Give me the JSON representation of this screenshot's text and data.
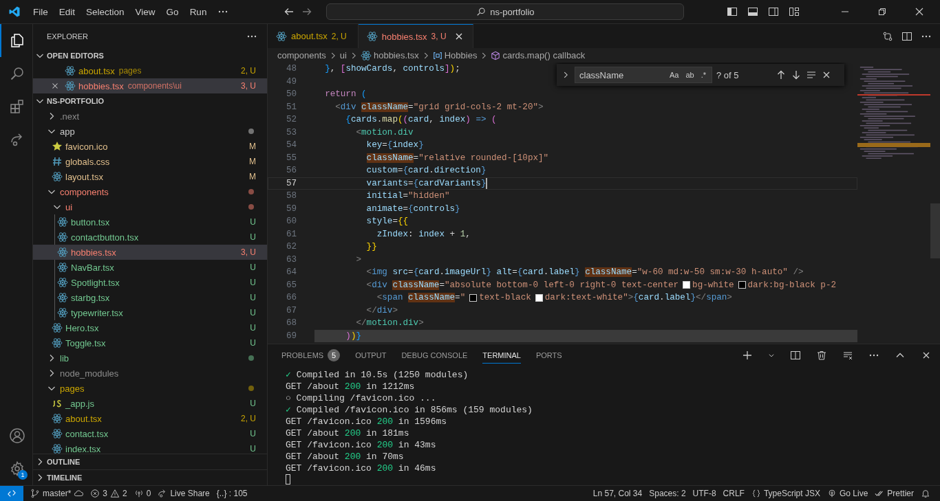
{
  "title_bar": {
    "menu": [
      "File",
      "Edit",
      "Selection",
      "View",
      "Go",
      "Run"
    ],
    "search": {
      "value": "ns-portfolio"
    }
  },
  "activity_bar": {
    "items": [
      {
        "kind": "explorer",
        "selected": true
      },
      {
        "kind": "search",
        "selected": false
      },
      {
        "kind": "extensions",
        "selected": false
      },
      {
        "kind": "live-share",
        "selected": false
      }
    ],
    "settings_badge": "1"
  },
  "explorer": {
    "title": "EXPLORER",
    "open_editors": {
      "title": "OPEN EDITORS",
      "expanded": true,
      "items": [
        {
          "name": "about.tsx",
          "path": "pages",
          "badge": "2, U",
          "color": "#cca700",
          "selected": false
        },
        {
          "name": "hobbies.tsx",
          "path": "components\\ui",
          "badge": "3, U",
          "color": "#f88070",
          "selected": true
        }
      ]
    },
    "project": {
      "title": "NS-PORTFOLIO",
      "expanded": true,
      "children": [
        {
          "name": ".next",
          "kind": "folder",
          "expanded": false,
          "color": "#8c8c8c",
          "dot": false,
          "selected": false
        },
        {
          "name": "app",
          "kind": "folder",
          "expanded": true,
          "color": "#cccccc",
          "dot": true,
          "selected": false,
          "children": [
            {
              "name": "favicon.ico",
              "kind": "star",
              "color": "#e2c08d",
              "badge": "M",
              "selected": false
            },
            {
              "name": "globals.css",
              "kind": "css",
              "color": "#e2c08d",
              "badge": "M",
              "selected": false
            },
            {
              "name": "layout.tsx",
              "kind": "react",
              "color": "#e2c08d",
              "badge": "M",
              "selected": false
            }
          ]
        },
        {
          "name": "components",
          "kind": "folder",
          "expanded": true,
          "color": "#f88070",
          "dot": true,
          "selected": false,
          "children": [
            {
              "name": "ui",
              "kind": "folder",
              "expanded": true,
              "color": "#f88070",
              "dot": true,
              "selected": false,
              "children": [
                {
                  "name": "button.tsx",
                  "kind": "react",
                  "color": "#73c991",
                  "badge": "U",
                  "selected": false
                },
                {
                  "name": "contactbutton.tsx",
                  "kind": "react",
                  "color": "#73c991",
                  "badge": "U",
                  "selected": false
                },
                {
                  "name": "hobbies.tsx",
                  "kind": "react",
                  "color": "#f88070",
                  "badge": "3, U",
                  "selected": true
                },
                {
                  "name": "NavBar.tsx",
                  "kind": "react",
                  "color": "#73c991",
                  "badge": "U",
                  "selected": false
                },
                {
                  "name": "Spotlight.tsx",
                  "kind": "react",
                  "color": "#73c991",
                  "badge": "U",
                  "selected": false
                },
                {
                  "name": "starbg.tsx",
                  "kind": "react",
                  "color": "#73c991",
                  "badge": "U",
                  "selected": false
                },
                {
                  "name": "typewriter.tsx",
                  "kind": "react",
                  "color": "#73c991",
                  "badge": "U",
                  "selected": false
                }
              ]
            },
            {
              "name": "Hero.tsx",
              "kind": "react",
              "color": "#73c991",
              "badge": "U",
              "selected": false
            },
            {
              "name": "Toggle.tsx",
              "kind": "react",
              "color": "#73c991",
              "badge": "U",
              "selected": false
            }
          ]
        },
        {
          "name": "lib",
          "kind": "folder",
          "expanded": false,
          "color": "#73c991",
          "dot": true,
          "selected": false
        },
        {
          "name": "node_modules",
          "kind": "folder",
          "expanded": false,
          "color": "#8c8c8c",
          "dot": false,
          "selected": false
        },
        {
          "name": "pages",
          "kind": "folder",
          "expanded": true,
          "color": "#cca700",
          "dot": true,
          "selected": false,
          "children": [
            {
              "name": "_app.js",
              "kind": "js",
              "color": "#73c991",
              "badge": "U",
              "selected": false
            },
            {
              "name": "about.tsx",
              "kind": "react",
              "color": "#cca700",
              "badge": "2, U",
              "selected": false
            },
            {
              "name": "contact.tsx",
              "kind": "react",
              "color": "#73c991",
              "badge": "U",
              "selected": false
            },
            {
              "name": "index.tsx",
              "kind": "react",
              "color": "#73c991",
              "badge": "U",
              "selected": false
            }
          ]
        }
      ]
    },
    "sections": [
      {
        "title": "OUTLINE",
        "expanded": false
      },
      {
        "title": "TIMELINE",
        "expanded": false
      }
    ]
  },
  "tabs": [
    {
      "name": "about.tsx",
      "badge": "2, U",
      "color": "#cca700",
      "selected": false
    },
    {
      "name": "hobbies.tsx",
      "badge": "3, U",
      "color": "#f88070",
      "selected": true
    }
  ],
  "breadcrumbs": [
    {
      "text": "components",
      "kind": "folder"
    },
    {
      "text": "ui",
      "kind": "folder"
    },
    {
      "text": "hobbies.tsx",
      "kind": "react"
    },
    {
      "text": "Hobbies",
      "kind": "symbol"
    },
    {
      "text": "cards.map() callback",
      "kind": "method"
    }
  ],
  "find": {
    "value": "className",
    "options": [
      {
        "label": "Aa",
        "on": false
      },
      {
        "label": "ab",
        "on": false
      },
      {
        "label": ".*",
        "on": false
      }
    ],
    "count": "? of 5"
  },
  "code": [
    {
      "number": "48",
      "kind": "plain",
      "tokens": [
        {
          "text": "  }",
          "kind": "b3"
        },
        {
          "text": ",",
          "kind": "plain"
        },
        {
          "text": " [",
          "kind": "b2"
        },
        {
          "text": "showCards",
          "kind": "var"
        },
        {
          "text": ",",
          "kind": "plain"
        },
        {
          "text": " controls",
          "kind": "var"
        },
        {
          "text": "]",
          "kind": "b2"
        },
        {
          "text": ")",
          "kind": "b1"
        },
        {
          "text": ";",
          "kind": "plain"
        }
      ]
    },
    {
      "number": "49",
      "kind": "plain"
    },
    {
      "number": "50",
      "kind": "plain",
      "tokens": [
        {
          "text": "  return",
          "kind": "kw"
        },
        {
          "text": " (",
          "kind": "b3"
        }
      ]
    },
    {
      "number": "51",
      "kind": "plain",
      "tokens": [
        {
          "text": "    <",
          "kind": "punct"
        },
        {
          "text": "div",
          "kind": "tag"
        },
        {
          "text": " className",
          "kind": "match"
        },
        {
          "text": "=",
          "kind": "plain"
        },
        {
          "text": "\"grid grid-cols-2 mt-20\"",
          "kind": "str"
        },
        {
          "text": ">",
          "kind": "punct"
        }
      ]
    },
    {
      "number": "52",
      "kind": "plain",
      "tokens": [
        {
          "text": "      {",
          "kind": "b3"
        },
        {
          "text": "cards",
          "kind": "var"
        },
        {
          "text": ".",
          "kind": "plain"
        },
        {
          "text": "map",
          "kind": "fn"
        },
        {
          "text": "(",
          "kind": "b1"
        },
        {
          "text": "(",
          "kind": "b2"
        },
        {
          "text": "card",
          "kind": "var"
        },
        {
          "text": ",",
          "kind": "plain"
        },
        {
          "text": " index",
          "kind": "var"
        },
        {
          "text": ")",
          "kind": "b2"
        },
        {
          "text": " =>",
          "kind": "tag"
        },
        {
          "text": " (",
          "kind": "b2"
        }
      ]
    },
    {
      "number": "53",
      "kind": "plain",
      "tokens": [
        {
          "text": "        <",
          "kind": "punct"
        },
        {
          "text": "motion.div",
          "kind": "comp"
        }
      ]
    },
    {
      "number": "54",
      "kind": "plain",
      "tokens": [
        {
          "text": "          key",
          "kind": "attr"
        },
        {
          "text": "=",
          "kind": "plain"
        },
        {
          "text": "{",
          "kind": "tag"
        },
        {
          "text": "index",
          "kind": "var"
        },
        {
          "text": "}",
          "kind": "tag"
        }
      ]
    },
    {
      "number": "55",
      "kind": "plain",
      "tokens": [
        {
          "text": "          className",
          "kind": "match"
        },
        {
          "text": "=",
          "kind": "plain"
        },
        {
          "text": "\"relative rounded-[10px]\"",
          "kind": "str"
        }
      ]
    },
    {
      "number": "56",
      "kind": "plain",
      "tokens": [
        {
          "text": "          custom",
          "kind": "attr"
        },
        {
          "text": "=",
          "kind": "plain"
        },
        {
          "text": "{",
          "kind": "tag"
        },
        {
          "text": "card",
          "kind": "var"
        },
        {
          "text": ".",
          "kind": "plain"
        },
        {
          "text": "direction",
          "kind": "var"
        },
        {
          "text": "}",
          "kind": "tag"
        }
      ]
    },
    {
      "number": "57",
      "kind": "current",
      "tokens": [
        {
          "text": "          variants",
          "kind": "attr"
        },
        {
          "text": "=",
          "kind": "plain"
        },
        {
          "text": "{",
          "kind": "tag"
        },
        {
          "text": "cardVariants",
          "kind": "var"
        },
        {
          "text": "}",
          "kind": "tag"
        }
      ]
    },
    {
      "number": "58",
      "kind": "plain",
      "tokens": [
        {
          "text": "          initial",
          "kind": "attr"
        },
        {
          "text": "=",
          "kind": "plain"
        },
        {
          "text": "\"hidden\"",
          "kind": "str"
        }
      ]
    },
    {
      "number": "59",
      "kind": "plain",
      "tokens": [
        {
          "text": "          animate",
          "kind": "attr"
        },
        {
          "text": "=",
          "kind": "plain"
        },
        {
          "text": "{",
          "kind": "tag"
        },
        {
          "text": "controls",
          "kind": "var"
        },
        {
          "text": "}",
          "kind": "tag"
        }
      ]
    },
    {
      "number": "60",
      "kind": "plain",
      "tokens": [
        {
          "text": "          style",
          "kind": "attr"
        },
        {
          "text": "=",
          "kind": "plain"
        },
        {
          "text": "{{",
          "kind": "b1"
        }
      ]
    },
    {
      "number": "61",
      "kind": "plain",
      "tokens": [
        {
          "text": "            zIndex",
          "kind": "var"
        },
        {
          "text": ":",
          "kind": "plain"
        },
        {
          "text": " index",
          "kind": "var"
        },
        {
          "text": " +",
          "kind": "plain"
        },
        {
          "text": " 1",
          "kind": "num"
        },
        {
          "text": ",",
          "kind": "plain"
        }
      ]
    },
    {
      "number": "62",
      "kind": "plain",
      "tokens": [
        {
          "text": "          }}",
          "kind": "b1"
        }
      ]
    },
    {
      "number": "63",
      "kind": "plain",
      "tokens": [
        {
          "text": "        >",
          "kind": "punct"
        }
      ]
    },
    {
      "number": "64",
      "kind": "plain",
      "tokens": [
        {
          "text": "          <",
          "kind": "punct"
        },
        {
          "text": "img",
          "kind": "tag"
        },
        {
          "text": " src",
          "kind": "attr"
        },
        {
          "text": "=",
          "kind": "plain"
        },
        {
          "text": "{",
          "kind": "tag"
        },
        {
          "text": "card",
          "kind": "var"
        },
        {
          "text": ".",
          "kind": "plain"
        },
        {
          "text": "imageUrl",
          "kind": "var"
        },
        {
          "text": "}",
          "kind": "tag"
        },
        {
          "text": " alt",
          "kind": "attr"
        },
        {
          "text": "=",
          "kind": "plain"
        },
        {
          "text": "{",
          "kind": "tag"
        },
        {
          "text": "card",
          "kind": "var"
        },
        {
          "text": ".",
          "kind": "plain"
        },
        {
          "text": "label",
          "kind": "var"
        },
        {
          "text": "}",
          "kind": "tag"
        },
        {
          "text": " className",
          "kind": "match"
        },
        {
          "text": "=",
          "kind": "plain"
        },
        {
          "text": "\"w-60 md:w-50 sm:w-30 h-auto\"",
          "kind": "str"
        },
        {
          "text": " />",
          "kind": "punct"
        }
      ]
    },
    {
      "number": "65",
      "kind": "plain",
      "tokens": [
        {
          "text": "          <",
          "kind": "punct"
        },
        {
          "text": "div",
          "kind": "tag"
        },
        {
          "text": " className",
          "kind": "match"
        },
        {
          "text": "=",
          "kind": "plain"
        },
        {
          "text": "\"absolute bottom-0 left-0 right-0 text-center",
          "kind": "str"
        },
        {
          "kind": "swatch",
          "color": "#ffffff"
        },
        {
          "text": "bg-white",
          "kind": "str"
        },
        {
          "kind": "swatch",
          "color": "#000000"
        },
        {
          "text": "dark:bg-black p-2",
          "kind": "str"
        }
      ]
    },
    {
      "number": "66",
      "kind": "plain",
      "tokens": [
        {
          "text": "            <",
          "kind": "punct"
        },
        {
          "text": "span",
          "kind": "tag"
        },
        {
          "text": " className",
          "kind": "match"
        },
        {
          "text": "=",
          "kind": "plain"
        },
        {
          "text": "\"",
          "kind": "str"
        },
        {
          "kind": "swatch",
          "color": "#000000"
        },
        {
          "text": "text-black",
          "kind": "str"
        },
        {
          "kind": "swatch",
          "color": "#ffffff"
        },
        {
          "text": "dark:text-white\"",
          "kind": "str"
        },
        {
          "text": ">",
          "kind": "punct"
        },
        {
          "text": "{",
          "kind": "tag"
        },
        {
          "text": "card",
          "kind": "var"
        },
        {
          "text": ".",
          "kind": "plain"
        },
        {
          "text": "label",
          "kind": "var"
        },
        {
          "text": "}",
          "kind": "tag"
        },
        {
          "text": "</",
          "kind": "punct"
        },
        {
          "text": "span",
          "kind": "tag"
        },
        {
          "text": ">",
          "kind": "punct"
        }
      ]
    },
    {
      "number": "67",
      "kind": "plain",
      "tokens": [
        {
          "text": "          </",
          "kind": "punct"
        },
        {
          "text": "div",
          "kind": "tag"
        },
        {
          "text": ">",
          "kind": "punct"
        }
      ]
    },
    {
      "number": "68",
      "kind": "plain",
      "tokens": [
        {
          "text": "        </",
          "kind": "punct"
        },
        {
          "text": "motion.div",
          "kind": "comp"
        },
        {
          "text": ">",
          "kind": "punct"
        }
      ]
    },
    {
      "number": "69",
      "kind": "hover",
      "tokens": [
        {
          "text": "      )",
          "kind": "b2"
        },
        {
          "text": ")",
          "kind": "b1"
        },
        {
          "text": "}",
          "kind": "b3"
        }
      ]
    }
  ],
  "panel": {
    "tabs": [
      {
        "label": "PROBLEMS",
        "badge": "5",
        "selected": false
      },
      {
        "label": "OUTPUT",
        "selected": false
      },
      {
        "label": "DEBUG CONSOLE",
        "selected": false
      },
      {
        "label": "TERMINAL",
        "selected": true
      },
      {
        "label": "PORTS",
        "selected": false
      }
    ],
    "terminal": [
      [
        {
          "text": "✓",
          "kind": "success"
        },
        {
          "text": " Compiled in 10.5s (1250 modules)",
          "kind": "plain"
        }
      ],
      [
        {
          "text": "GET /about ",
          "kind": "plain"
        },
        {
          "text": "200",
          "kind": "success"
        },
        {
          "text": " in 1212ms",
          "kind": "plain"
        }
      ],
      [
        {
          "text": "○ Compiling /favicon.ico ...",
          "kind": "plain"
        }
      ],
      [
        {
          "text": "✓",
          "kind": "success"
        },
        {
          "text": " Compiled /favicon.ico in 856ms (159 modules)",
          "kind": "plain"
        }
      ],
      [
        {
          "text": "GET /favicon.ico ",
          "kind": "plain"
        },
        {
          "text": "200",
          "kind": "success"
        },
        {
          "text": " in 1596ms",
          "kind": "plain"
        }
      ],
      [
        {
          "text": "GET /about ",
          "kind": "plain"
        },
        {
          "text": "200",
          "kind": "success"
        },
        {
          "text": " in 181ms",
          "kind": "plain"
        }
      ],
      [
        {
          "text": "GET /favicon.ico ",
          "kind": "plain"
        },
        {
          "text": "200",
          "kind": "success"
        },
        {
          "text": " in 43ms",
          "kind": "plain"
        }
      ],
      [
        {
          "text": "GET /about ",
          "kind": "plain"
        },
        {
          "text": "200",
          "kind": "success"
        },
        {
          "text": " in 70ms",
          "kind": "plain"
        }
      ],
      [
        {
          "text": "GET /favicon.ico ",
          "kind": "plain"
        },
        {
          "text": "200",
          "kind": "success"
        },
        {
          "text": " in 46ms",
          "kind": "plain"
        }
      ]
    ]
  },
  "status_bar": {
    "left": [
      {
        "kind": "branch",
        "text": "master*"
      },
      {
        "kind": "problems",
        "errors": "3",
        "warnings": "2"
      },
      {
        "kind": "ports",
        "text": "0"
      },
      {
        "kind": "live-share",
        "text": "Live Share"
      },
      {
        "kind": "plain",
        "text": "{..} : 105"
      }
    ],
    "right": [
      {
        "kind": "plain",
        "text": "Ln 57, Col 34"
      },
      {
        "kind": "plain",
        "text": "Spaces: 2"
      },
      {
        "kind": "plain",
        "text": "UTF-8"
      },
      {
        "kind": "plain",
        "text": "CRLF"
      },
      {
        "kind": "language",
        "text": "TypeScript JSX"
      },
      {
        "kind": "go-live",
        "text": "Go Live"
      },
      {
        "kind": "prettier",
        "text": "Prettier"
      }
    ]
  }
}
